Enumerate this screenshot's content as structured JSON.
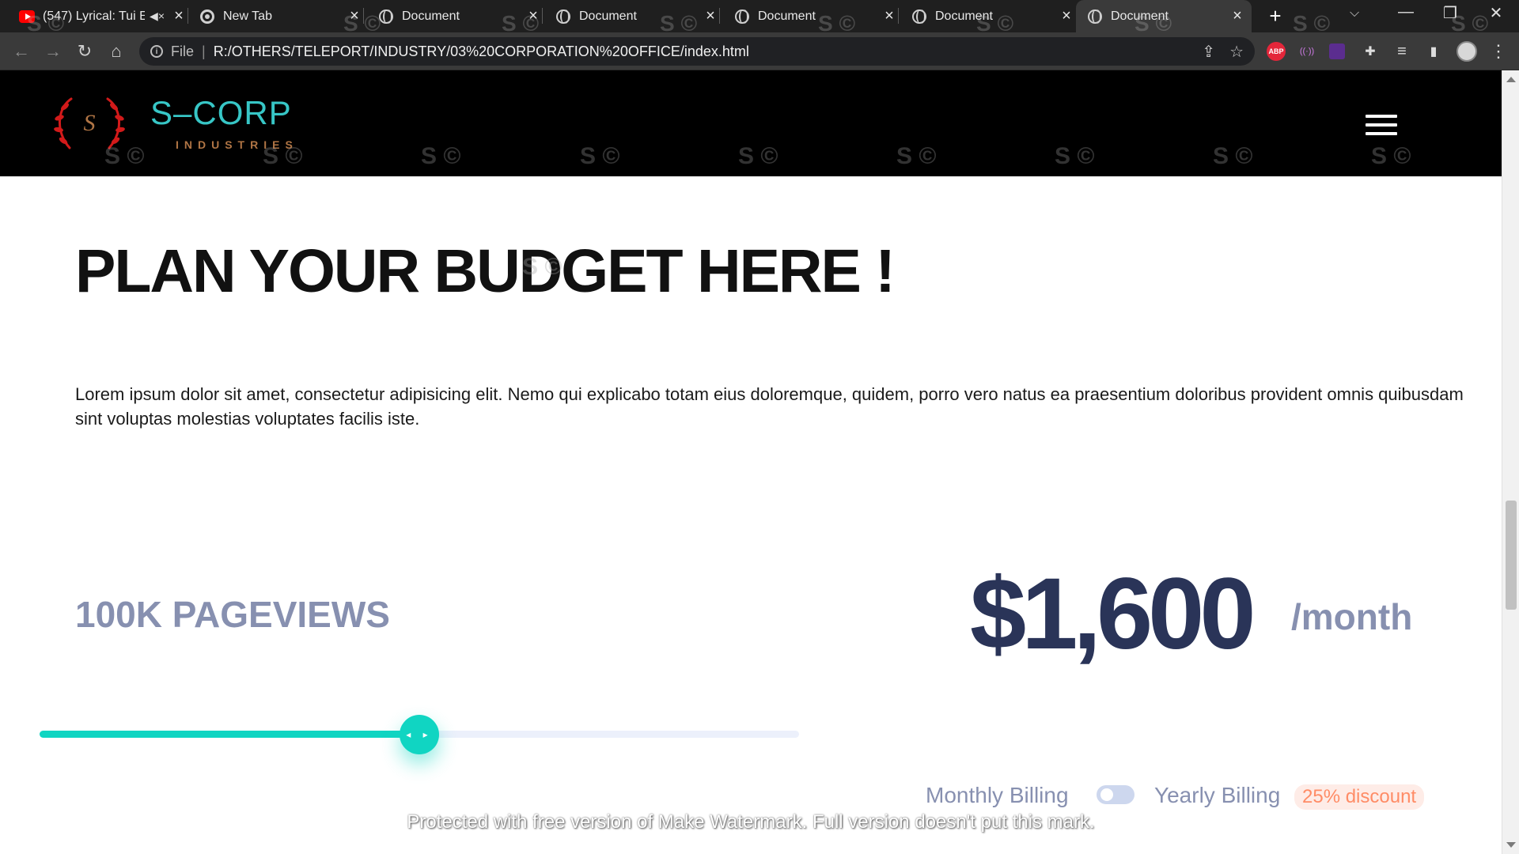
{
  "browser": {
    "tabs": [
      {
        "title": "(547) Lyrical: Tui E",
        "icon": "youtube-icon",
        "muted_icon": "speaker-muted-icon",
        "close": "×"
      },
      {
        "title": "New Tab",
        "icon": "chrome-icon",
        "close": "×"
      },
      {
        "title": "Document",
        "icon": "globe-icon",
        "close": "×"
      },
      {
        "title": "Document",
        "icon": "globe-icon",
        "close": "×"
      },
      {
        "title": "Document",
        "icon": "globe-icon",
        "close": "×"
      },
      {
        "title": "Document",
        "icon": "globe-icon",
        "close": "×"
      },
      {
        "title": "Document",
        "icon": "globe-icon",
        "close": "×",
        "active": true
      }
    ],
    "new_tab": "+",
    "tab_search": "⌵",
    "window_controls": {
      "minimize": "—",
      "restore": "❐",
      "close": "✕"
    },
    "nav": {
      "back": "←",
      "forward": "→",
      "reload": "↻",
      "home": "⌂"
    },
    "omnibox": {
      "info": "i",
      "scheme_label": "File",
      "separator": "|",
      "url": "R:/OTHERS/TELEPORT/INDUSTRY/03%20CORPORATION%20OFFICE/index.html",
      "share": "⇪",
      "bookmark": "☆"
    },
    "extensions": {
      "abp": "ABP",
      "radio": "((·))",
      "puzzle": "✚",
      "media": "≡",
      "sidepanel": "▮",
      "menu": "⋮"
    }
  },
  "site": {
    "logo": {
      "monogram": "S",
      "name": "S–CORP",
      "tagline": "INDUSTRIES"
    },
    "headline": "PLAN YOUR BUDGET HERE !",
    "description": "Lorem ipsum dolor sit amet, consectetur adipisicing elit. Nemo qui explicabo totam eius doloremque, quidem, porro vero natus ea praesentium doloribus provident omnis quibusdam sint voluptas molestias voluptates facilis iste.",
    "pricing": {
      "pageviews": "100K PAGEVIEWS",
      "price": "$1,600",
      "period": "/month",
      "slider_value_fraction": 0.5,
      "thumb_glyph": "◂ ▸",
      "billing_monthly": "Monthly Billing",
      "billing_yearly": "Yearly Billing",
      "discount": "25% discount"
    },
    "watermark_stamp": "S ©",
    "watermark_banner": "Protected with free version of Make Watermark. Full version doesn't put this mark."
  },
  "colors": {
    "accent": "#10d5c2",
    "price_text": "#2a3458",
    "muted_text": "#8790b0",
    "discount_text": "#ff8c66",
    "discount_bg": "#feece7",
    "logo_cyan": "#37c6c6",
    "logo_red": "#d21a1a"
  }
}
